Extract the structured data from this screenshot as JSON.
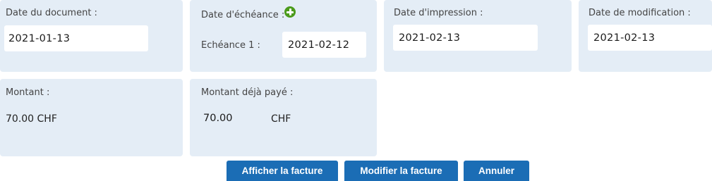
{
  "dates": {
    "document": {
      "label": "Date du document :",
      "value": "2021-01-13"
    },
    "due": {
      "label": "Date d'échéance :",
      "add_icon": "plus-circle-icon",
      "item_label": "Echéance 1 :",
      "item_value": "2021-02-12"
    },
    "print": {
      "label": "Date d'impression :",
      "value": "2021-02-13"
    },
    "modified": {
      "label": "Date de modification :",
      "value": "2021-02-13"
    }
  },
  "amounts": {
    "total": {
      "label": "Montant :",
      "value": "70.00 CHF"
    },
    "paid": {
      "label": "Montant déjà payé :",
      "value": "70.00",
      "currency": "CHF"
    }
  },
  "actions": {
    "show_invoice": "Afficher la facture",
    "edit_invoice": "Modifier la facture",
    "cancel": "Annuler"
  },
  "colors": {
    "card_background": "#e4edf6",
    "button": "#1b6db5",
    "add_icon": "#4b9b1c"
  }
}
